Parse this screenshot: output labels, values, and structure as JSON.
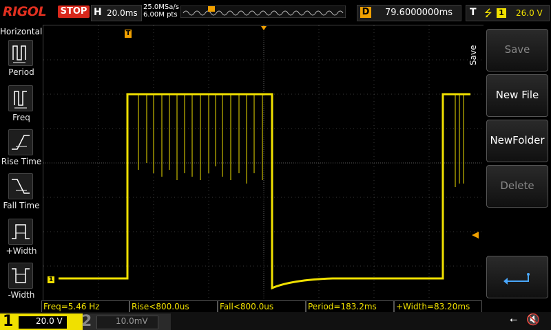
{
  "brand": "RIGOL",
  "run_status": "STOP",
  "horizontal": {
    "label": "H",
    "timebase": "20.0ms",
    "sample_rate": "25.0MSa/s",
    "memory_depth": "6.00M pts"
  },
  "trigger_position": {
    "label": "D",
    "delay": "79.6000000ms"
  },
  "trigger": {
    "label": "T",
    "edge_icon": "rising-edge-icon",
    "source": "1",
    "level": "26.0 V"
  },
  "left_menu": {
    "title": "Horizontal",
    "items": [
      {
        "label": "Period",
        "icon": "period-icon"
      },
      {
        "label": "Freq",
        "icon": "freq-icon"
      },
      {
        "label": "Rise Time",
        "icon": "rise-time-icon"
      },
      {
        "label": "Fall Time",
        "icon": "fall-time-icon"
      },
      {
        "label": "+Width",
        "icon": "plus-width-icon"
      },
      {
        "label": "-Width",
        "icon": "minus-width-icon"
      }
    ]
  },
  "right_menu": {
    "title": "Save",
    "buttons": [
      {
        "label": "Save",
        "enabled": false
      },
      {
        "label": "New File",
        "enabled": true
      },
      {
        "label": "NewFolder",
        "enabled": true
      },
      {
        "label": "Delete",
        "enabled": false
      }
    ],
    "return_icon": "return-arrow-icon"
  },
  "measurements": [
    "Freq=5.46 Hz",
    "Rise<800.0us",
    "Fall<800.0us",
    "Period=183.2ms",
    "+Width=83.20ms"
  ],
  "channels": [
    {
      "number": "1",
      "scale": "20.0 V",
      "active": true,
      "color": "#f0e000"
    },
    {
      "number": "2",
      "scale": "10.0mV",
      "active": false,
      "color": "#888888"
    }
  ],
  "markers": {
    "trigger_marker": "T",
    "channel_marker": "1"
  },
  "colors": {
    "trace": "#f0e000",
    "stop": "#d8281c",
    "trigger_pos": "#f0a000"
  }
}
